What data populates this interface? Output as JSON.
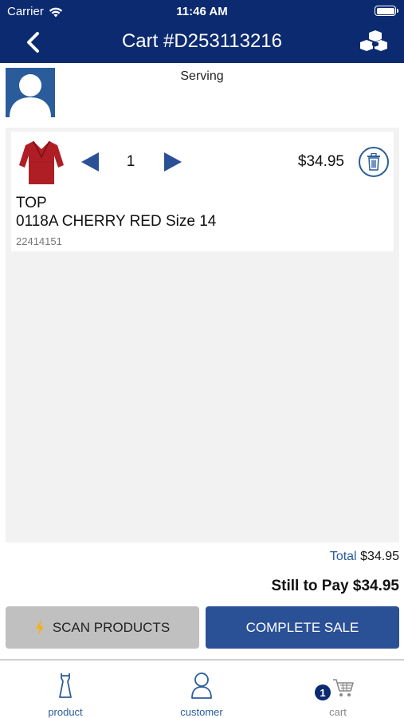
{
  "status_bar": {
    "carrier": "Carrier",
    "time": "11:46 AM"
  },
  "nav": {
    "title": "Cart #D253113216"
  },
  "customer": {
    "serving_label": "Serving"
  },
  "cart": {
    "items": [
      {
        "name": "TOP",
        "description": "0118A CHERRY RED Size 14",
        "sku": "22414151",
        "quantity": "1",
        "price": "$34.95"
      }
    ]
  },
  "totals": {
    "total_label": "Total",
    "total_value": "$34.95",
    "still_to_pay": "Still to Pay $34.95"
  },
  "actions": {
    "scan_label": "SCAN PRODUCTS",
    "complete_label": "COMPLETE SALE"
  },
  "tabs": {
    "product": "product",
    "customer": "customer",
    "cart": "cart",
    "cart_badge": "1"
  },
  "colors": {
    "nav_bg": "#0c2a6f",
    "accent": "#2a5c9c",
    "complete_button": "#2a5096",
    "scan_button": "#c0c0c0",
    "product_red": "#b01e25"
  }
}
